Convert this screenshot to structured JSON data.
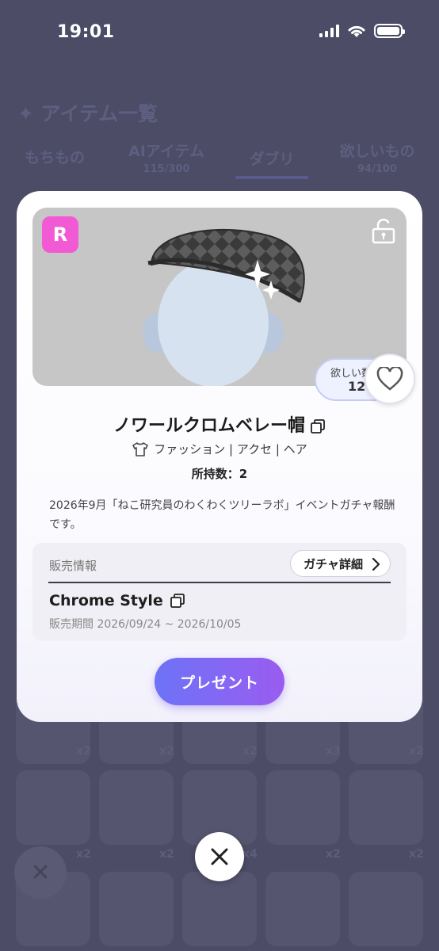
{
  "status_bar": {
    "time": "19:01"
  },
  "background": {
    "title": "✦ アイテム一覧",
    "tabs": [
      {
        "label": "もちもの",
        "count": ""
      },
      {
        "label": "AIアイテム",
        "count": "115/300"
      },
      {
        "label": "ダブリ",
        "count": ""
      },
      {
        "label": "欲しいもの",
        "count": "94/100"
      }
    ],
    "counts_row1": [
      "x2",
      "x2",
      "x2",
      "x3",
      "x2"
    ],
    "counts_row2": [
      "x2",
      "x2",
      "x4",
      "x2",
      "x2"
    ]
  },
  "item": {
    "rarity": "R",
    "name": "ノワールクロムベレー帽",
    "categories": "ファッション | アクセ | ヘア",
    "owned": "所持数：2",
    "wish_label": "欲しい数",
    "wish_count": "1264",
    "description": "2026年9月「ねこ研究員のわくわくツリーラボ」イベントガチャ報酬です。"
  },
  "sale": {
    "label": "販売情報",
    "detail_button": "ガチャ詳細",
    "name": "Chrome Style",
    "period": "販売期間 2026/09/24 ~ 2026/10/05"
  },
  "actions": {
    "present": "プレゼント"
  },
  "colors": {
    "accent_start": "#6d73f7",
    "accent_end": "#9a5cf0",
    "rarity": "#f15ad4",
    "overlay": "#4c4c66"
  }
}
